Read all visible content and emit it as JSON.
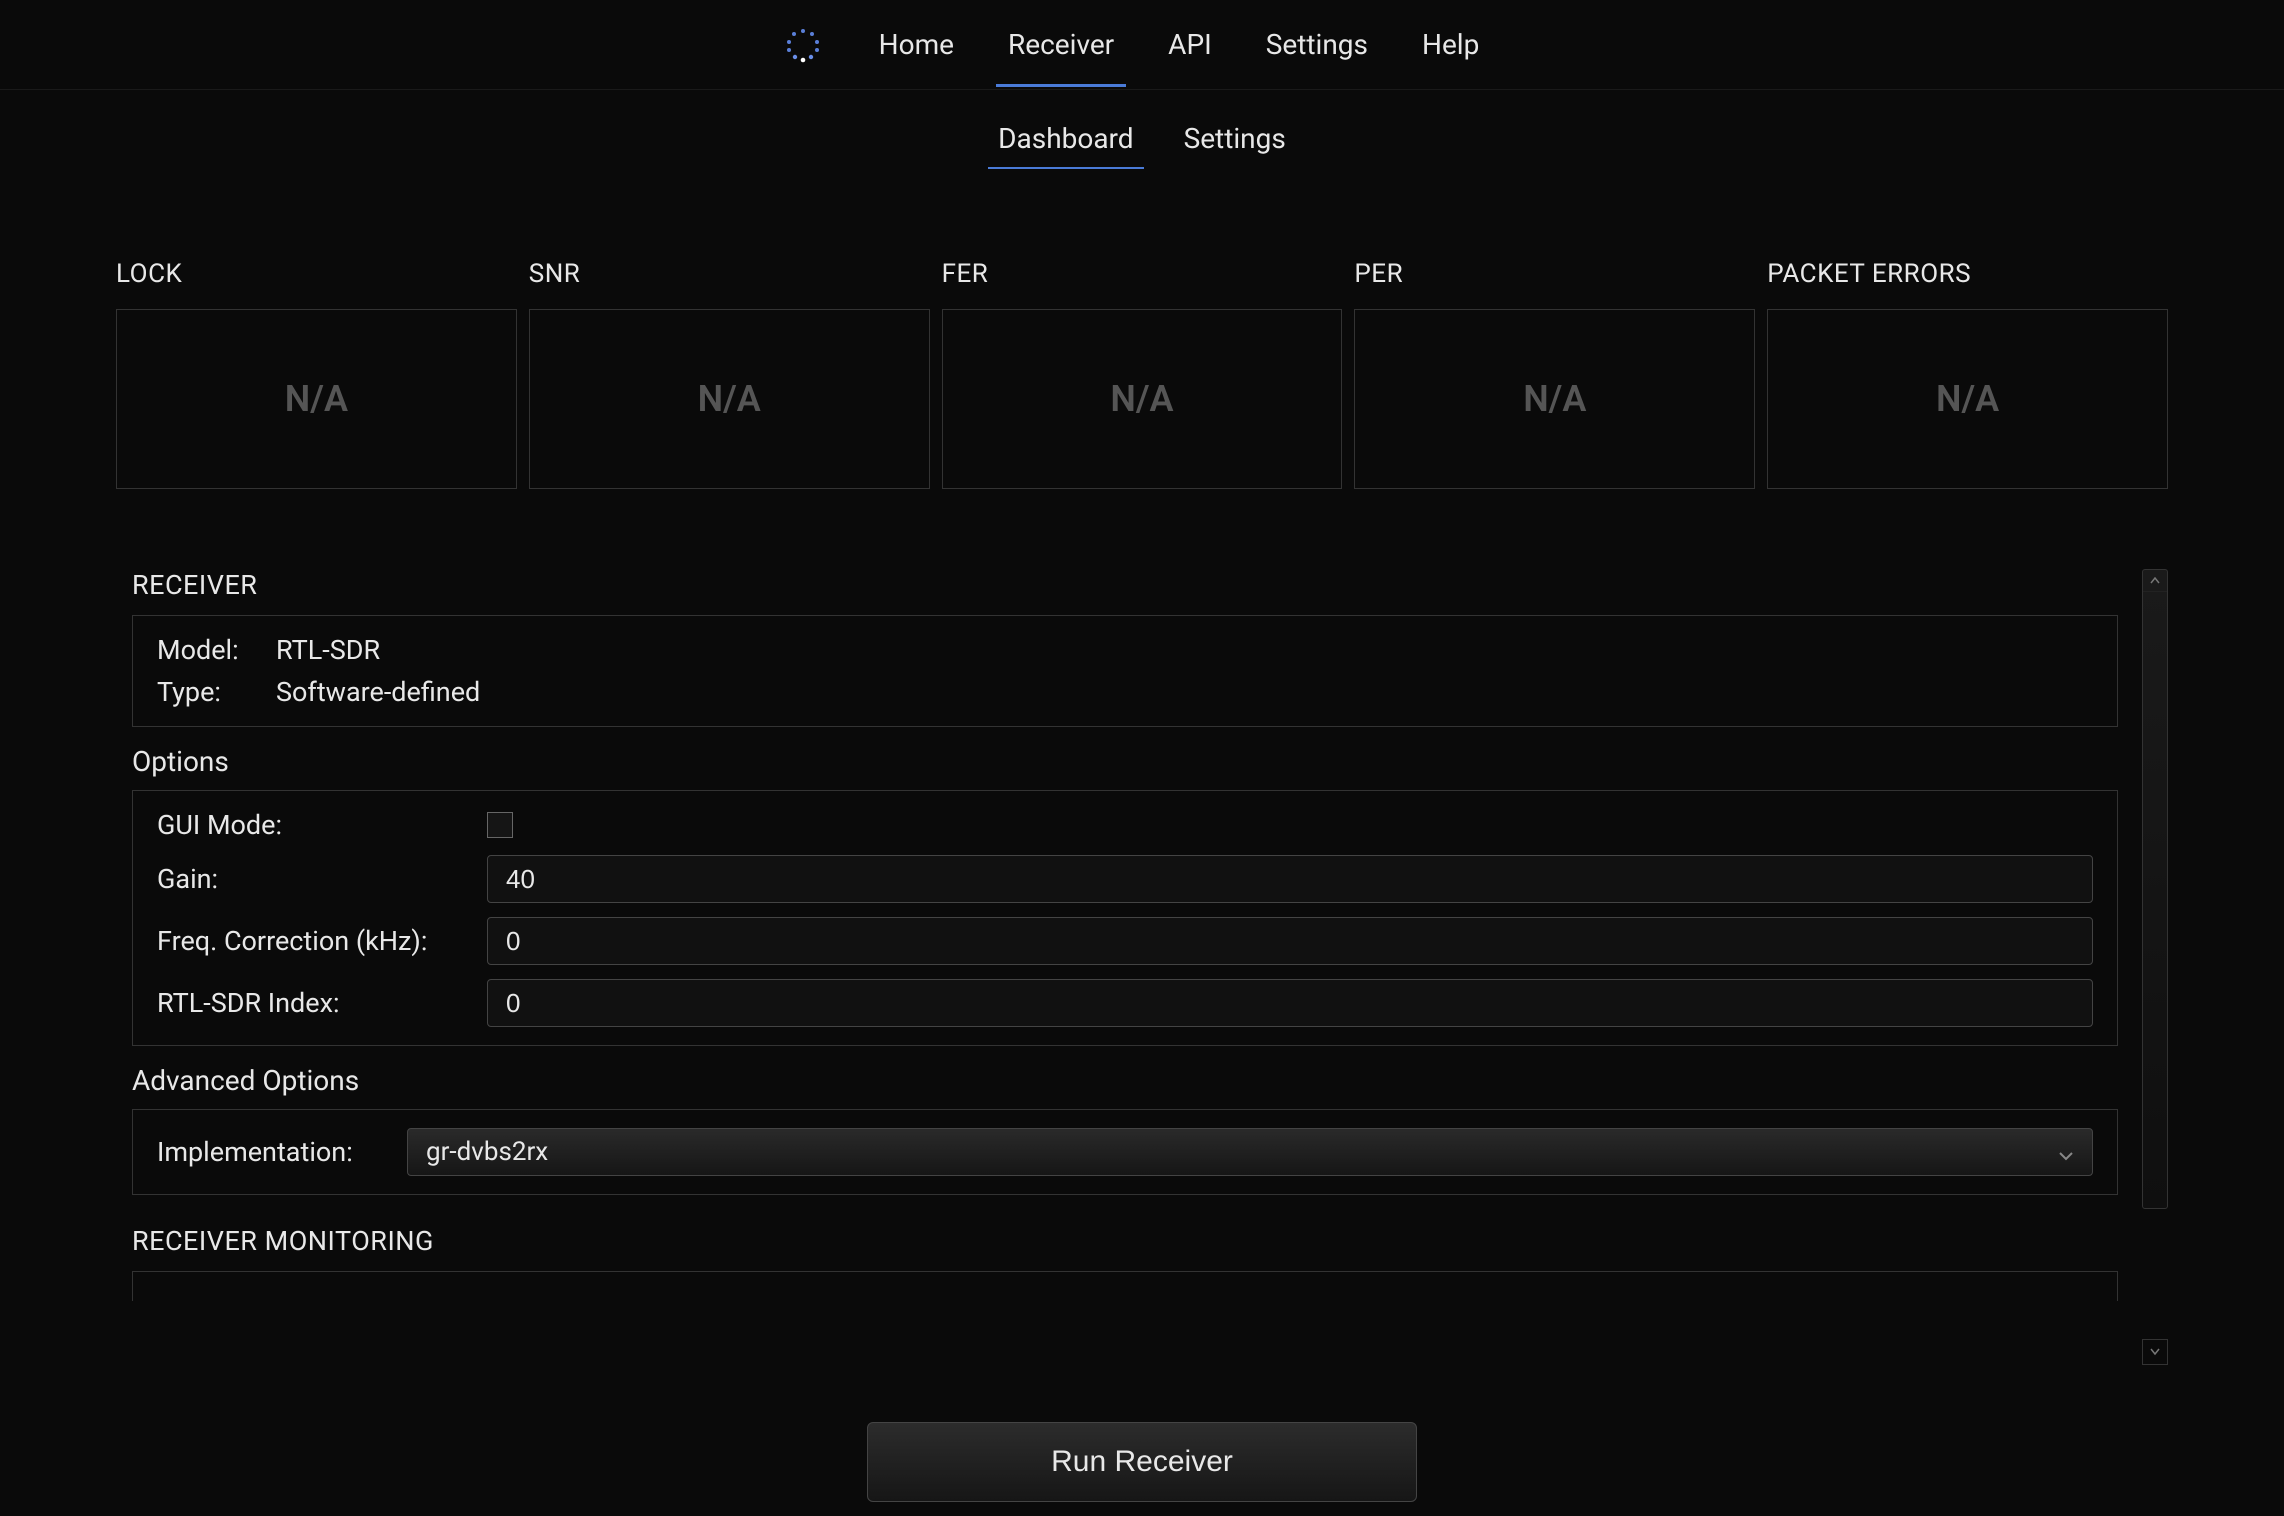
{
  "topNav": [
    {
      "label": "Home",
      "active": false
    },
    {
      "label": "Receiver",
      "active": true
    },
    {
      "label": "API",
      "active": false
    },
    {
      "label": "Settings",
      "active": false
    },
    {
      "label": "Help",
      "active": false
    }
  ],
  "subNav": [
    {
      "label": "Dashboard",
      "active": true
    },
    {
      "label": "Settings",
      "active": false
    }
  ],
  "stats": [
    {
      "label": "LOCK",
      "value": "N/A"
    },
    {
      "label": "SNR",
      "value": "N/A"
    },
    {
      "label": "FER",
      "value": "N/A"
    },
    {
      "label": "PER",
      "value": "N/A"
    },
    {
      "label": "PACKET ERRORS",
      "value": "N/A"
    }
  ],
  "receiver": {
    "section_title": "RECEIVER",
    "model_label": "Model:",
    "model_value": "RTL-SDR",
    "type_label": "Type:",
    "type_value": "Software-defined",
    "options_title": "Options",
    "gui_mode_label": "GUI Mode:",
    "gui_mode_checked": false,
    "gain_label": "Gain:",
    "gain_value": "40",
    "freq_correction_label": "Freq. Correction (kHz):",
    "freq_correction_value": "0",
    "rtl_index_label": "RTL-SDR Index:",
    "rtl_index_value": "0",
    "advanced_title": "Advanced Options",
    "implementation_label": "Implementation:",
    "implementation_value": "gr-dvbs2rx"
  },
  "monitoring": {
    "section_title": "RECEIVER MONITORING"
  },
  "footer": {
    "run_button_label": "Run Receiver"
  }
}
